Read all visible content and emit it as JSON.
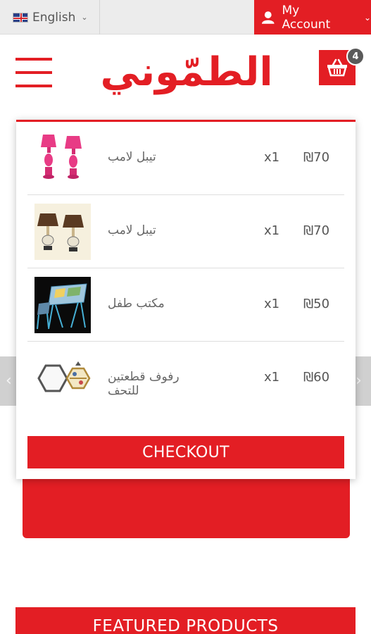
{
  "topbar": {
    "language": "English",
    "account": "My Account"
  },
  "header": {
    "logo_text": "الطمّوني",
    "cart_count": "4"
  },
  "cart": {
    "items": [
      {
        "name": "تيبل لامب",
        "qty": "x1",
        "price": "₪70",
        "image": "pink-table-lamps"
      },
      {
        "name": "تيبل لامب",
        "qty": "x1",
        "price": "₪70",
        "image": "brown-table-lamps"
      },
      {
        "name": "مكتب طفل",
        "qty": "x1",
        "price": "₪50",
        "image": "kids-desk"
      },
      {
        "name": "رفوف قطعتين للتحف",
        "qty": "x1",
        "price": "₪60",
        "image": "hexagon-shelves"
      }
    ],
    "checkout_label": "CHECKOUT"
  },
  "page": {
    "featured_label": "FEATURED PRODUCTS"
  },
  "colors": {
    "brand_red": "#e31e24",
    "topbar_grey": "#ececec"
  }
}
